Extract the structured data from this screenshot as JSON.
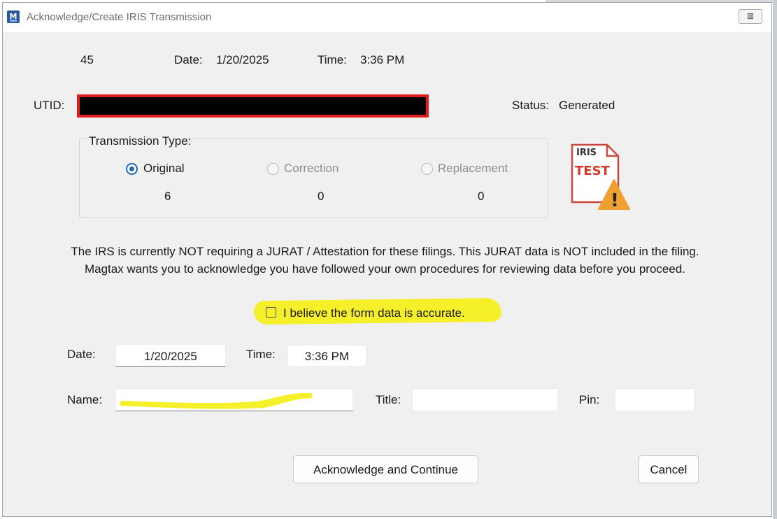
{
  "window": {
    "title": "Acknowledge/Create IRIS Transmission",
    "app_icon_letter": "M",
    "close_glyph": "⊠"
  },
  "header": {
    "id_value": "45",
    "date_label": "Date:",
    "date_value": "1/20/2025",
    "time_label": "Time:",
    "time_value": "3:36 PM"
  },
  "utid": {
    "label": "UTID:",
    "redacted": true,
    "redaction_fill": "#000000",
    "redaction_border": "#e01c1c"
  },
  "status": {
    "label": "Status:",
    "value": "Generated"
  },
  "transmission_type": {
    "title": "Transmission Type:",
    "options": [
      {
        "label": "Original",
        "count": "6",
        "selected": true,
        "enabled": true
      },
      {
        "label": "Correction",
        "count": "0",
        "selected": false,
        "enabled": false
      },
      {
        "label": "Replacement",
        "count": "0",
        "selected": false,
        "enabled": false
      }
    ]
  },
  "status_icon": {
    "name": "iris-test-warning-icon",
    "top_text": "IRIS",
    "main_text": "TEST",
    "warning_glyph": "!"
  },
  "jurat_notice": {
    "line1": "The IRS is currently NOT requiring a JURAT / Attestation for these filings. This JURAT data is NOT included in the filing.",
    "line2": "Magtax wants you to acknowledge you have followed your own procedures for reviewing data before you proceed."
  },
  "acknowledge": {
    "checkbox_label": "I believe the form data is accurate.",
    "checked": false,
    "highlight_color": "#f5f02a"
  },
  "form": {
    "date_label": "Date:",
    "date_value": "1/20/2025",
    "time_label": "Time:",
    "time_value": "3:36 PM",
    "name_label": "Name:",
    "name_value": "",
    "title_label": "Title:",
    "title_value": "",
    "pin_label": "Pin:",
    "pin_value": ""
  },
  "buttons": {
    "acknowledge": "Acknowledge and Continue",
    "cancel": "Cancel"
  },
  "colors": {
    "accent": "#1f67b5",
    "window_bg": "#f0f0f0",
    "redaction_border": "#e01c1c",
    "icon_red": "#d23a2a",
    "warning": "#f0a030"
  }
}
